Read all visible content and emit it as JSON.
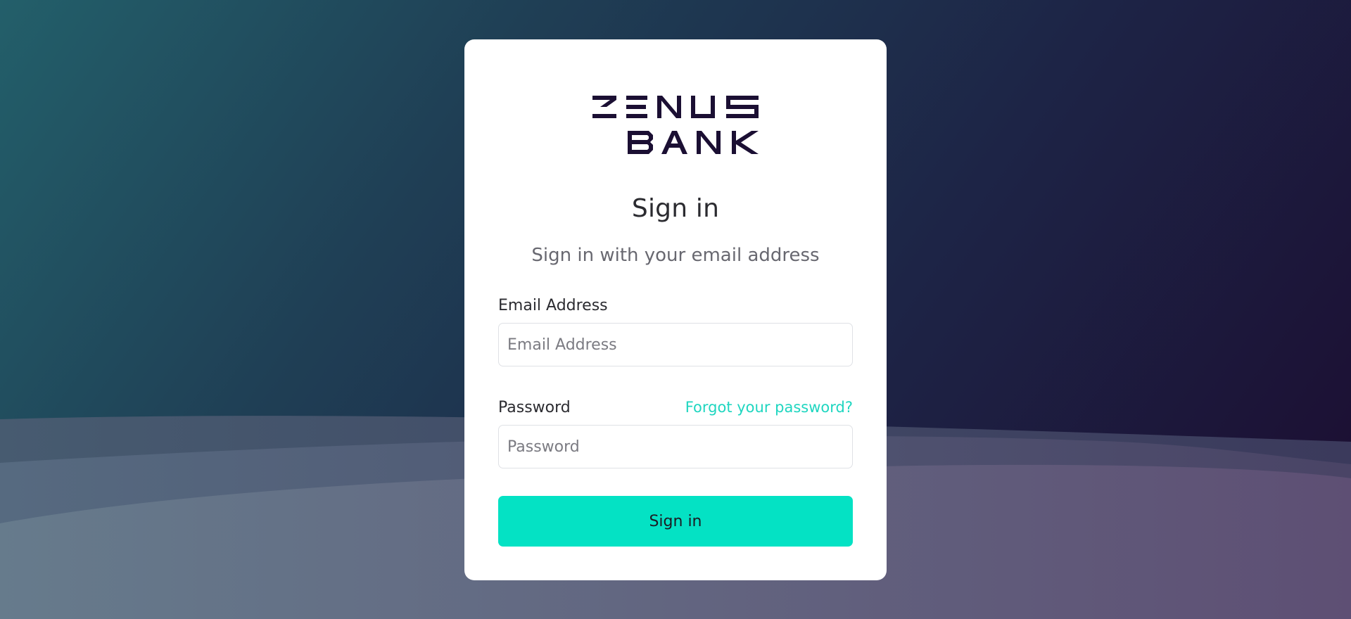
{
  "brand": {
    "name_line1": "ZENUS",
    "name_line2": "BANK",
    "logo_color": "#1b0f33"
  },
  "signin": {
    "title": "Sign in",
    "subtitle": "Sign in with your email address"
  },
  "email": {
    "label": "Email Address",
    "placeholder": "Email Address",
    "value": ""
  },
  "password": {
    "label": "Password",
    "placeholder": "Password",
    "value": "",
    "forgot_link": "Forgot your password?"
  },
  "submit": {
    "label": "Sign in"
  },
  "colors": {
    "accent": "#04e2c4",
    "link": "#1fd6c0",
    "text": "#2b2b30",
    "muted": "#686870"
  }
}
